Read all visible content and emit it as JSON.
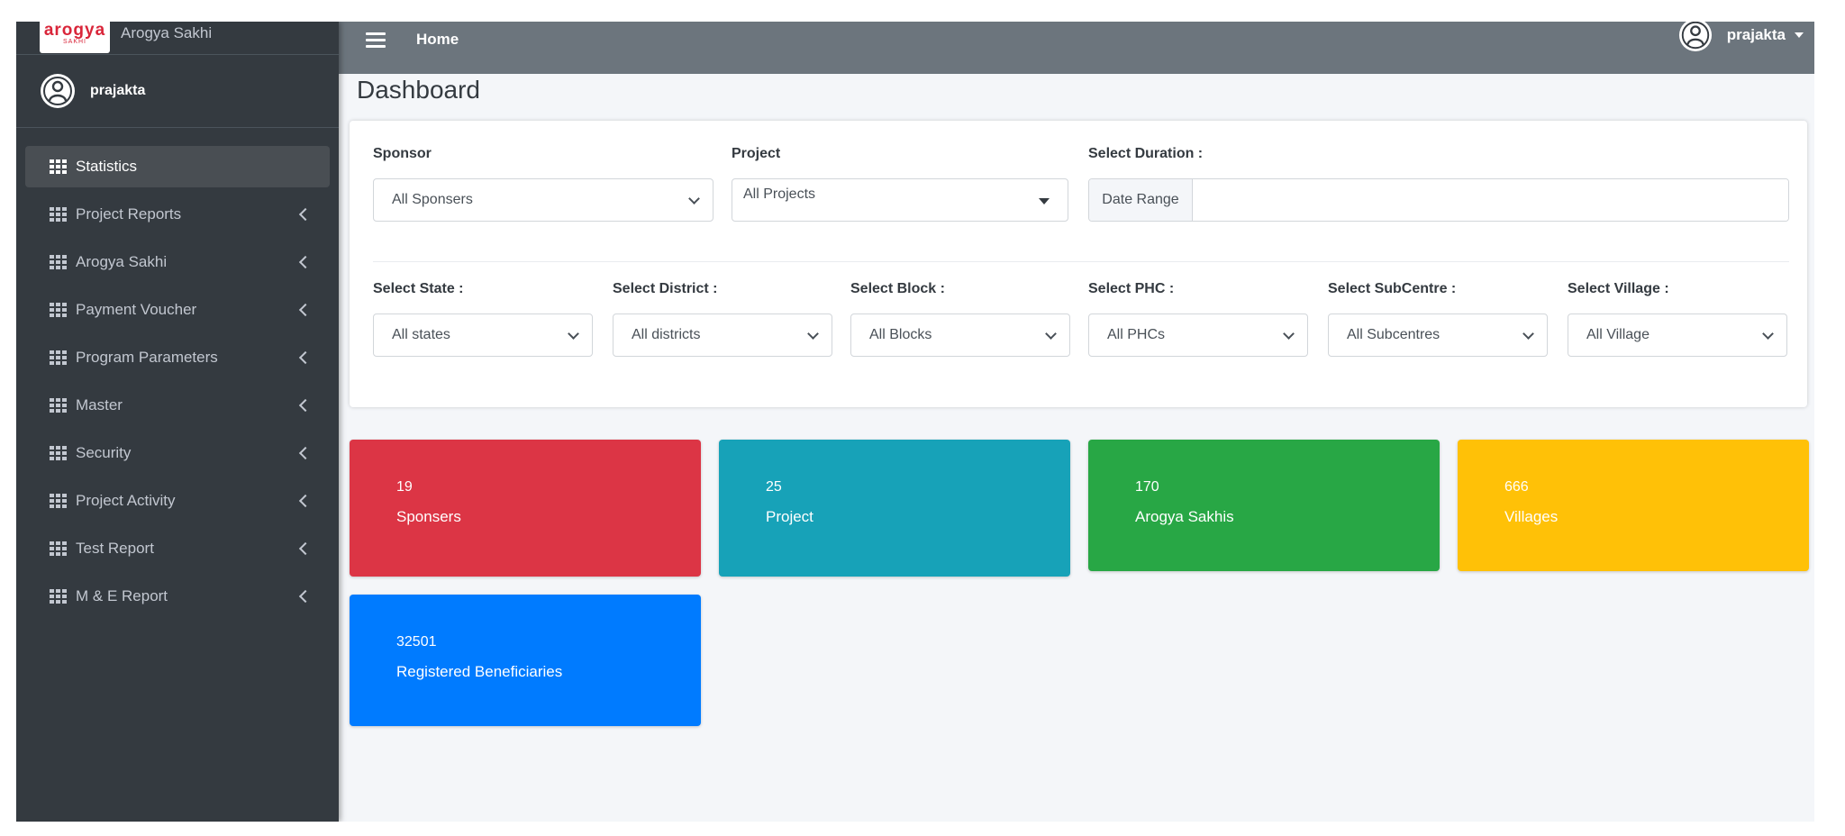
{
  "brand": {
    "name": "Arogya Sakhi",
    "logo_main": "arogya",
    "logo_sub": "SAKHI"
  },
  "sidebar": {
    "user": "prajakta",
    "items": [
      {
        "label": "Statistics",
        "icon": "grid-icon",
        "active": true,
        "has_children": false
      },
      {
        "label": "Project Reports",
        "icon": "grid-icon",
        "active": false,
        "has_children": true
      },
      {
        "label": "Arogya Sakhi",
        "icon": "grid-icon",
        "active": false,
        "has_children": true
      },
      {
        "label": "Payment Voucher",
        "icon": "grid-icon",
        "active": false,
        "has_children": true
      },
      {
        "label": "Program Parameters",
        "icon": "grid-icon",
        "active": false,
        "has_children": true
      },
      {
        "label": "Master",
        "icon": "grid-icon",
        "active": false,
        "has_children": true
      },
      {
        "label": "Security",
        "icon": "grid-icon",
        "active": false,
        "has_children": true
      },
      {
        "label": "Project Activity",
        "icon": "grid-icon",
        "active": false,
        "has_children": true
      },
      {
        "label": "Test Report",
        "icon": "grid-icon",
        "active": false,
        "has_children": true
      },
      {
        "label": "M & E Report",
        "icon": "grid-icon",
        "active": false,
        "has_children": true
      }
    ]
  },
  "topbar": {
    "home_label": "Home",
    "user": "prajakta"
  },
  "page": {
    "title": "Dashboard"
  },
  "filters": {
    "sponsor": {
      "label": "Sponsor",
      "value": "All Sponsers"
    },
    "project": {
      "label": "Project",
      "value": "All Projects"
    },
    "duration": {
      "label": "Select Duration :",
      "prefix": "Date Range",
      "value": ""
    },
    "state": {
      "label": "Select State :",
      "value": "All states"
    },
    "district": {
      "label": "Select District :",
      "value": "All districts"
    },
    "block": {
      "label": "Select Block :",
      "value": "All Blocks"
    },
    "phc": {
      "label": "Select PHC :",
      "value": "All PHCs"
    },
    "subcentre": {
      "label": "Select SubCentre :",
      "value": "All Subcentres"
    },
    "village": {
      "label": "Select Village :",
      "value": "All Village"
    }
  },
  "stats": [
    {
      "value": "19",
      "label": "Sponsers",
      "color": "#dc3545"
    },
    {
      "value": "25",
      "label": "Project",
      "color": "#17a2b8"
    },
    {
      "value": "170",
      "label": "Arogya Sakhis",
      "color": "#28a745"
    },
    {
      "value": "666",
      "label": "Villages",
      "color": "#ffc107"
    },
    {
      "value": "32501",
      "label": "Registered Beneficiaries",
      "color": "#007bff"
    }
  ],
  "colors": {
    "sidebar_bg": "#343a40",
    "topbar_bg": "#6c757d",
    "content_bg": "#f4f6f9"
  }
}
